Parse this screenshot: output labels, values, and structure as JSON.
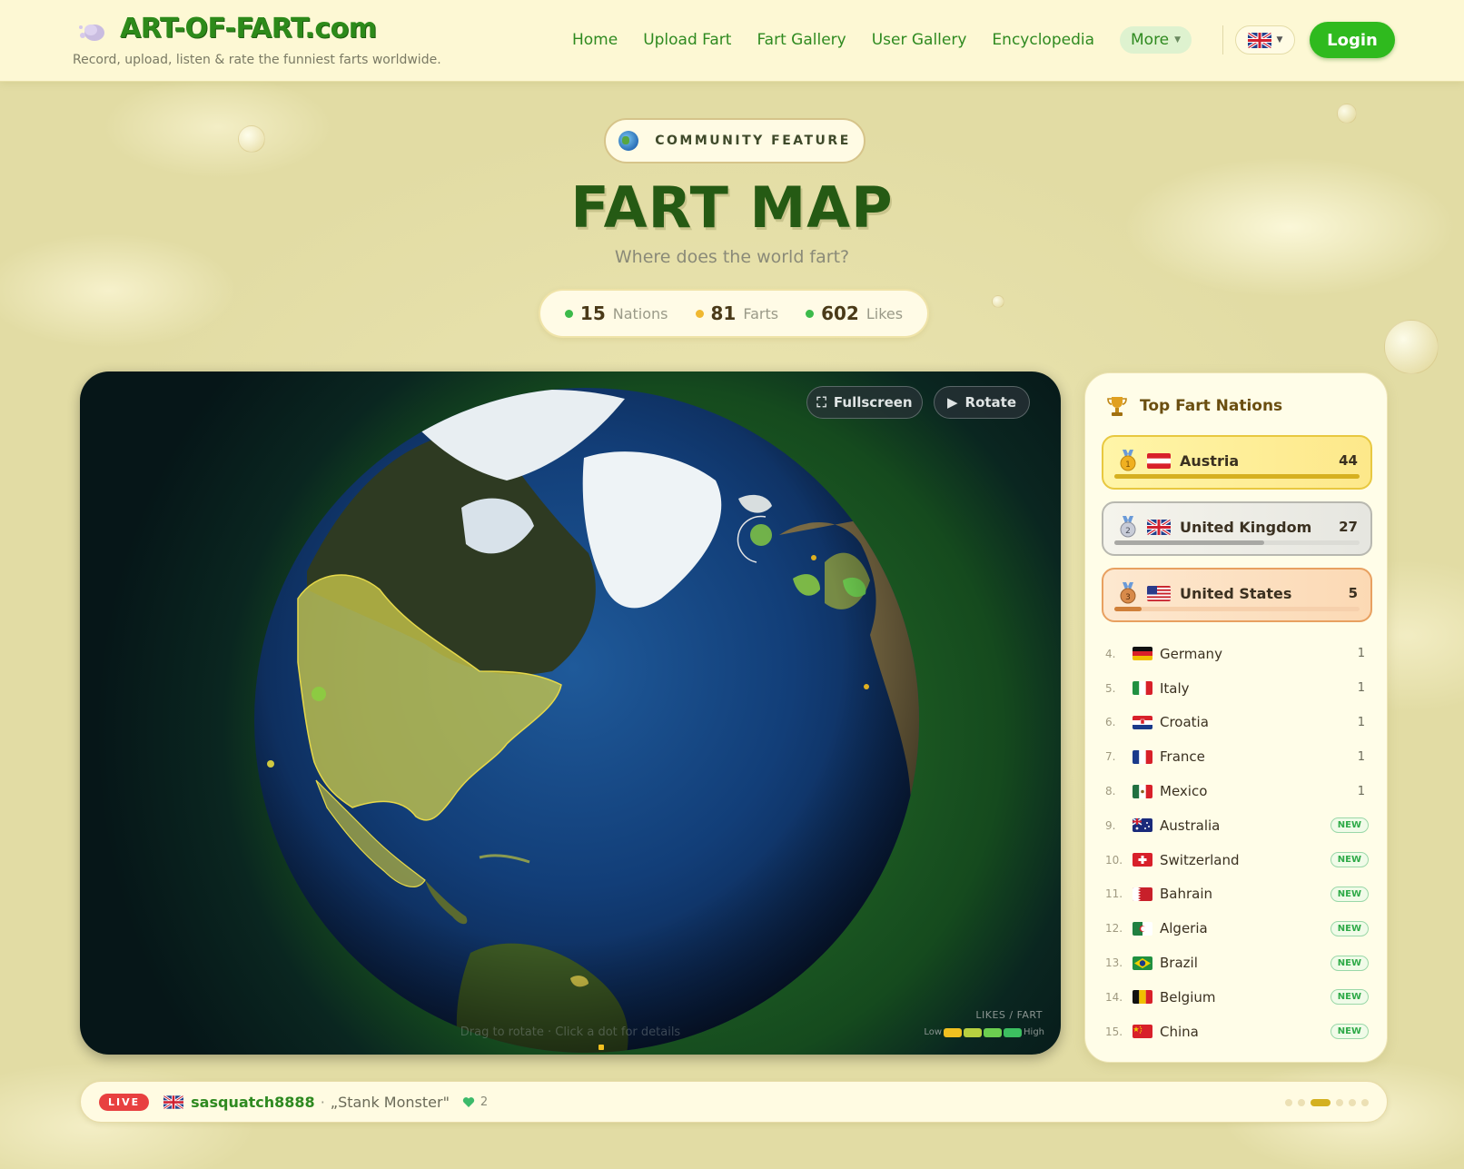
{
  "header": {
    "logo_text": "ART-OF-FART.com",
    "tagline": "Record, upload, listen & rate the funniest farts worldwide.",
    "nav": [
      "Home",
      "Upload Fart",
      "Fart Gallery",
      "User Gallery",
      "Encyclopedia"
    ],
    "more_label": "More",
    "language": "uk-flag",
    "login_label": "Login"
  },
  "hero": {
    "badge": "COMMUNITY FEATURE",
    "title": "FART MAP",
    "subtitle": "Where does the world fart?",
    "stats": [
      {
        "value": "15",
        "label": "Nations",
        "color": "#3cba4a"
      },
      {
        "value": "81",
        "label": "Farts",
        "color": "#f0b830"
      },
      {
        "value": "602",
        "label": "Likes",
        "color": "#3cba4a"
      }
    ]
  },
  "globe": {
    "fullscreen_label": "Fullscreen",
    "rotate_label": "Rotate",
    "legend_title": "LIKES / FART",
    "legend_low": "Low",
    "legend_high": "High",
    "legend_colors": [
      "#f0c020",
      "#b8d040",
      "#6ccf50",
      "#3cbf60"
    ],
    "hint": "Drag to rotate · Click a dot for details"
  },
  "sidebar": {
    "title": "Top Fart Nations",
    "top3": [
      {
        "rank": "1",
        "name": "Austria",
        "count": "44",
        "share": 1.0
      },
      {
        "rank": "2",
        "name": "United Kingdom",
        "count": "27",
        "share": 0.61
      },
      {
        "rank": "3",
        "name": "United States",
        "count": "5",
        "share": 0.11
      }
    ],
    "list": [
      {
        "rank": "4.",
        "name": "Germany",
        "count": "1",
        "flag": "de"
      },
      {
        "rank": "5.",
        "name": "Italy",
        "count": "1",
        "flag": "it"
      },
      {
        "rank": "6.",
        "name": "Croatia",
        "count": "1",
        "flag": "hr"
      },
      {
        "rank": "7.",
        "name": "France",
        "count": "1",
        "flag": "fr"
      },
      {
        "rank": "8.",
        "name": "Mexico",
        "count": "1",
        "flag": "mx"
      },
      {
        "rank": "9.",
        "name": "Australia",
        "count": "NEW",
        "flag": "au"
      },
      {
        "rank": "10.",
        "name": "Switzerland",
        "count": "NEW",
        "flag": "ch"
      },
      {
        "rank": "11.",
        "name": "Bahrain",
        "count": "NEW",
        "flag": "bh"
      },
      {
        "rank": "12.",
        "name": "Algeria",
        "count": "NEW",
        "flag": "dz"
      },
      {
        "rank": "13.",
        "name": "Brazil",
        "count": "NEW",
        "flag": "br"
      },
      {
        "rank": "14.",
        "name": "Belgium",
        "count": "NEW",
        "flag": "be"
      },
      {
        "rank": "15.",
        "name": "China",
        "count": "NEW",
        "flag": "cn"
      }
    ]
  },
  "ticker": {
    "live_label": "LIVE",
    "user": "sasquatch8888",
    "separator": "·",
    "fart_title": "„Stank Monster\"",
    "likes": "2"
  }
}
